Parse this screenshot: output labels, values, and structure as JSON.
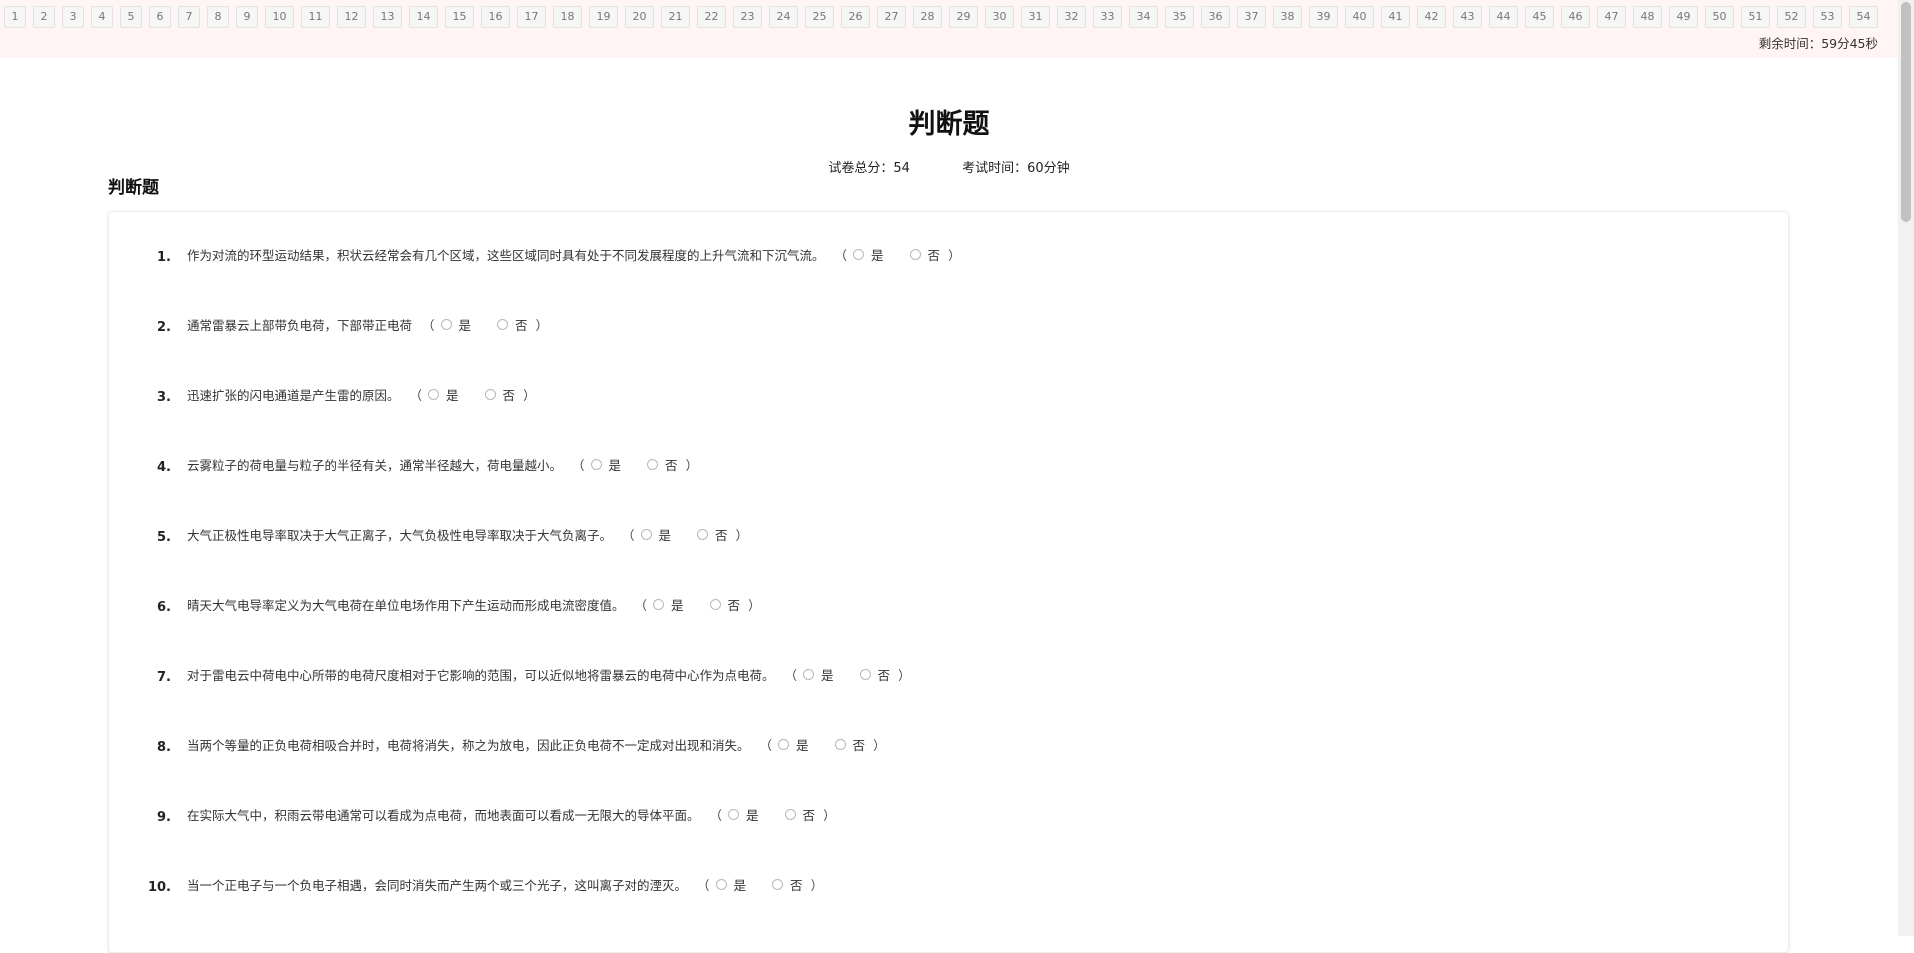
{
  "nav": {
    "buttons": [
      "1",
      "2",
      "3",
      "4",
      "5",
      "6",
      "7",
      "8",
      "9",
      "10",
      "11",
      "12",
      "13",
      "14",
      "15",
      "16",
      "17",
      "18",
      "19",
      "20",
      "21",
      "22",
      "23",
      "24",
      "25",
      "26",
      "27",
      "28",
      "29",
      "30",
      "31",
      "32",
      "33",
      "34",
      "35",
      "36",
      "37",
      "38",
      "39",
      "40",
      "41",
      "42",
      "43",
      "44",
      "45",
      "46",
      "47",
      "48",
      "49",
      "50",
      "51",
      "52",
      "53",
      "54"
    ],
    "timer": "剩余时间：59分45秒"
  },
  "page": {
    "title": "判断题",
    "total_score": "试卷总分：54",
    "exam_time": "考试时间：60分钟"
  },
  "section": {
    "title": "判断题"
  },
  "options": {
    "open": "（",
    "yes": "是",
    "no": "否",
    "close": "）"
  },
  "questions": [
    {
      "num": "1.",
      "text": "作为对流的环型运动结果，积状云经常会有几个区域，这些区域同时具有处于不同发展程度的上升气流和下沉气流。"
    },
    {
      "num": "2.",
      "text": "通常雷暴云上部带负电荷，下部带正电荷"
    },
    {
      "num": "3.",
      "text": "迅速扩张的闪电通道是产生雷的原因。"
    },
    {
      "num": "4.",
      "text": "云雾粒子的荷电量与粒子的半径有关，通常半径越大，荷电量越小。"
    },
    {
      "num": "5.",
      "text": "大气正极性电导率取决于大气正离子，大气负极性电导率取决于大气负离子。"
    },
    {
      "num": "6.",
      "text": "晴天大气电导率定义为大气电荷在单位电场作用下产生运动而形成电流密度值。"
    },
    {
      "num": "7.",
      "text": "对于雷电云中荷电中心所带的电荷尺度相对于它影响的范围，可以近似地将雷暴云的电荷中心作为点电荷。"
    },
    {
      "num": "8.",
      "text": "当两个等量的正负电荷相吸合并时，电荷将消失，称之为放电，因此正负电荷不一定成对出现和消失。"
    },
    {
      "num": "9.",
      "text": "在实际大气中，积雨云带电通常可以看成为点电荷，而地表面可以看成一无限大的导体平面。"
    },
    {
      "num": "10.",
      "text": "当一个正电子与一个负电子相遇，会同时消失而产生两个或三个光子，这叫离子对的湮灭。"
    }
  ]
}
